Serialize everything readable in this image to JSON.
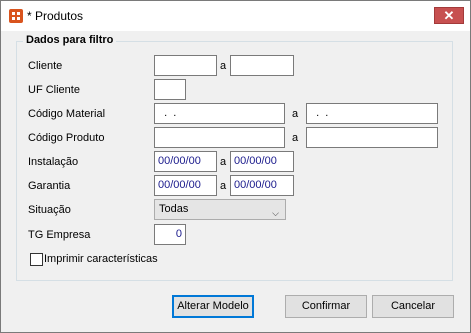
{
  "window": {
    "title": "* Produtos",
    "close_symbol": "✕"
  },
  "group": {
    "title": "Dados para filtro"
  },
  "fields": {
    "cliente": {
      "label": "Cliente",
      "sep": "a",
      "from": "",
      "to": ""
    },
    "uf_cliente": {
      "label": "UF Cliente",
      "value": ""
    },
    "codigo_material": {
      "label": "Código Material",
      "sep": "a",
      "from": "  .  .",
      "to": "  .  ."
    },
    "codigo_produto": {
      "label": "Código Produto",
      "sep": "a",
      "from": "",
      "to": ""
    },
    "instalacao": {
      "label": "Instalação",
      "sep": "a",
      "from": "00/00/00",
      "to": "00/00/00"
    },
    "garantia": {
      "label": "Garantia",
      "sep": "a",
      "from": "00/00/00",
      "to": "00/00/00"
    },
    "situacao": {
      "label": "Situação",
      "selected": "Todas"
    },
    "tg_empresa": {
      "label": "TG Empresa",
      "value": "0"
    },
    "imprimir": {
      "label": "Imprimir características",
      "checked": false
    }
  },
  "buttons": {
    "alterar_modelo": "Alterar Modelo",
    "confirmar": "Confirmar",
    "cancelar": "Cancelar"
  },
  "icons": {
    "app": "app-grid-icon",
    "close": "close-icon",
    "dropdown": "chevron-down-icon"
  }
}
